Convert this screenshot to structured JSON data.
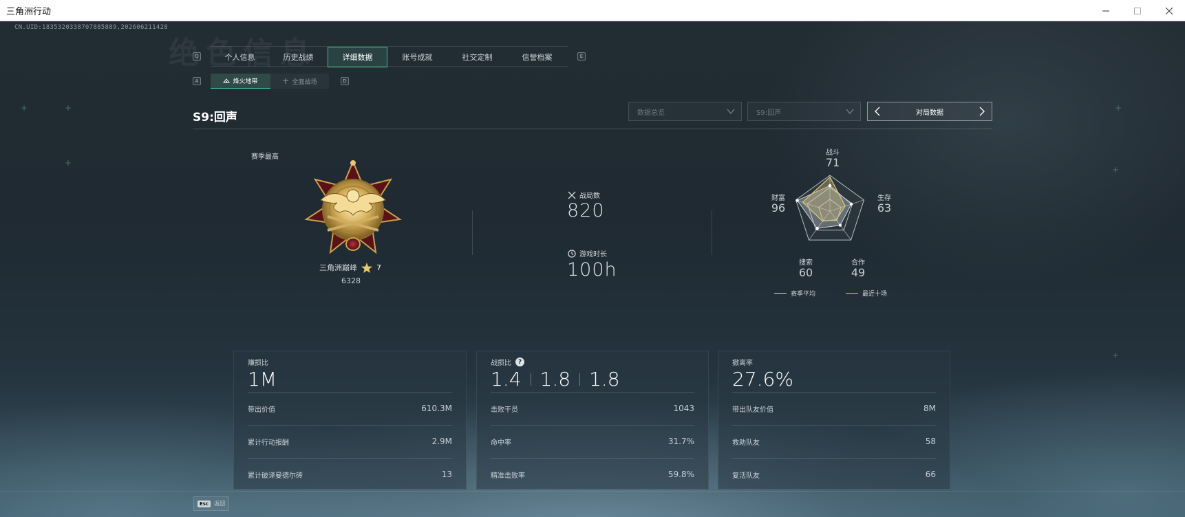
{
  "window": {
    "title": "三角洲行动"
  },
  "uid": "CN.UID:1835320338707885889,202606211428",
  "watermark": "绝色信息",
  "tabs": [
    {
      "label": "个人信息"
    },
    {
      "label": "历史战绩"
    },
    {
      "label": "详细数据",
      "active": true
    },
    {
      "label": "账号成就"
    },
    {
      "label": "社交定制"
    },
    {
      "label": "信誉档案"
    }
  ],
  "keyhints": {
    "prev": "Q",
    "next": "E",
    "sub_prev": "A",
    "sub_next": "D"
  },
  "subtabs": [
    {
      "label": "烽火地带",
      "active": true
    },
    {
      "label": "全面战场"
    }
  ],
  "season": {
    "title": "S9:回声",
    "filter1": "数据总览",
    "filter2": "S9:回声",
    "pager_label": "对局数据"
  },
  "rank": {
    "season_best_label": "赛季最高",
    "name": "三角洲巅峰",
    "stars": "7",
    "score": "6328"
  },
  "stats": {
    "matches_label": "战局数",
    "matches_value": "820",
    "playtime_label": "游戏时长",
    "playtime_value": "100h"
  },
  "radar": {
    "axes": [
      {
        "label": "战斗",
        "value": "71"
      },
      {
        "label": "生存",
        "value": "63"
      },
      {
        "label": "合作",
        "value": "49"
      },
      {
        "label": "搜索",
        "value": "60"
      },
      {
        "label": "财富",
        "value": "96"
      }
    ],
    "legend_avg": "赛季平均",
    "legend_recent": "最近十场",
    "colors": {
      "avg": "#c9d2d8",
      "recent": "#d9c27a"
    }
  },
  "cards": {
    "profit": {
      "title": "赚损比",
      "big": "1M",
      "rows": [
        {
          "label": "带出价值",
          "value": "610.3M"
        },
        {
          "label": "累计行动报酬",
          "value": "2.9M"
        },
        {
          "label": "累计破译曼德尔砖",
          "value": "13"
        }
      ]
    },
    "combat": {
      "title": "战损比",
      "q": "?",
      "bigs": [
        "1.4",
        "1.8",
        "1.8"
      ],
      "rows": [
        {
          "label": "击败干员",
          "value": "1043"
        },
        {
          "label": "命中率",
          "value": "31.7%"
        },
        {
          "label": "精准击败率",
          "value": "59.8%"
        }
      ]
    },
    "extract": {
      "title": "撤离率",
      "big": "27.6%",
      "rows": [
        {
          "label": "带出队友价值",
          "value": "8M"
        },
        {
          "label": "救助队友",
          "value": "58"
        },
        {
          "label": "复活队友",
          "value": "66"
        }
      ]
    }
  },
  "footer": {
    "esc_key": "Esc",
    "esc_label": "返回"
  },
  "accent": "#3fbf94"
}
